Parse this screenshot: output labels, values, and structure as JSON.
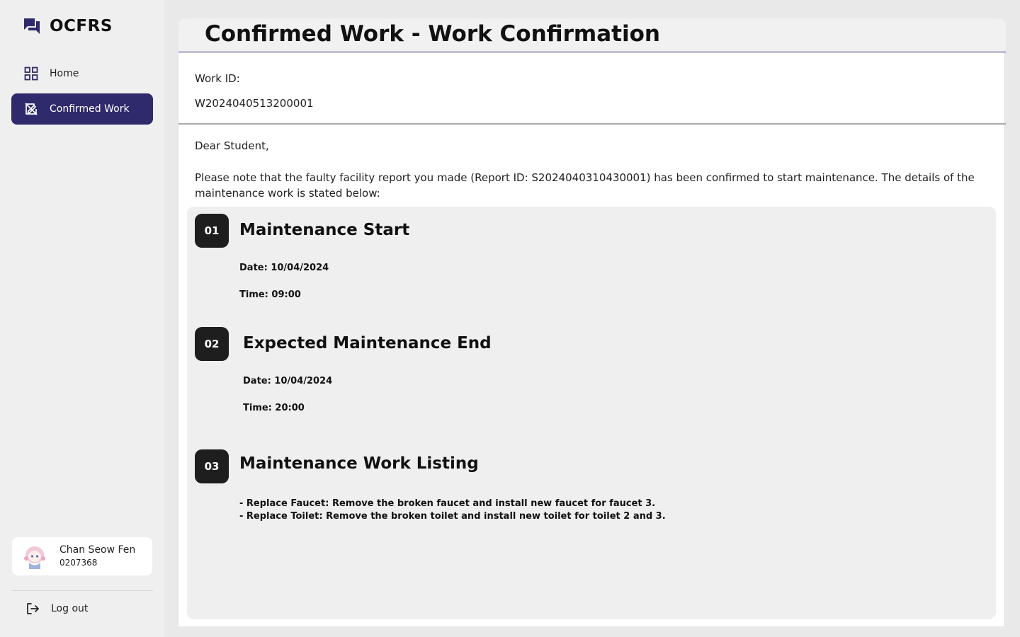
{
  "app": {
    "name": "OCFRS"
  },
  "sidebar": {
    "items": [
      {
        "label": "Home",
        "icon": "grid-icon",
        "active": false
      },
      {
        "label": "Confirmed Work",
        "icon": "confirmed-work-icon",
        "active": true
      }
    ],
    "user": {
      "name": "Chan Seow Fen",
      "id": "0207368",
      "avatar": "avatar-image"
    },
    "logout_label": "Log out"
  },
  "page": {
    "title": "Confirmed Work - Work Confirmation",
    "work_id_label": "Work ID:",
    "work_id_value": "W2024040513200001",
    "greeting": "Dear Student,",
    "message": "Please note that the faulty facility report you made (Report ID: S2024040310430001) has been confirmed to start maintenance. The details of the maintenance work is stated below:",
    "steps": [
      {
        "number": "01",
        "title": "Maintenance Start",
        "lines": [
          "Date: 10/04/2024",
          "Time: 09:00"
        ]
      },
      {
        "number": "02",
        "title": "Expected Maintenance End",
        "lines": [
          "Date: 10/04/2024",
          "Time: 20:00"
        ]
      },
      {
        "number": "03",
        "title": "Maintenance Work Listing",
        "lines": [
          "- Replace Faucet: Remove the broken faucet and install new faucet for faucet 3.",
          "- Replace Toilet: Remove the broken toilet and install new toilet for toilet 2 and 3."
        ]
      }
    ]
  },
  "colors": {
    "accent": "#2f2a6b",
    "badge": "#1e1e1e",
    "background": "#e9e9e9",
    "sidebar": "#efefef",
    "details_panel": "#efefef"
  }
}
